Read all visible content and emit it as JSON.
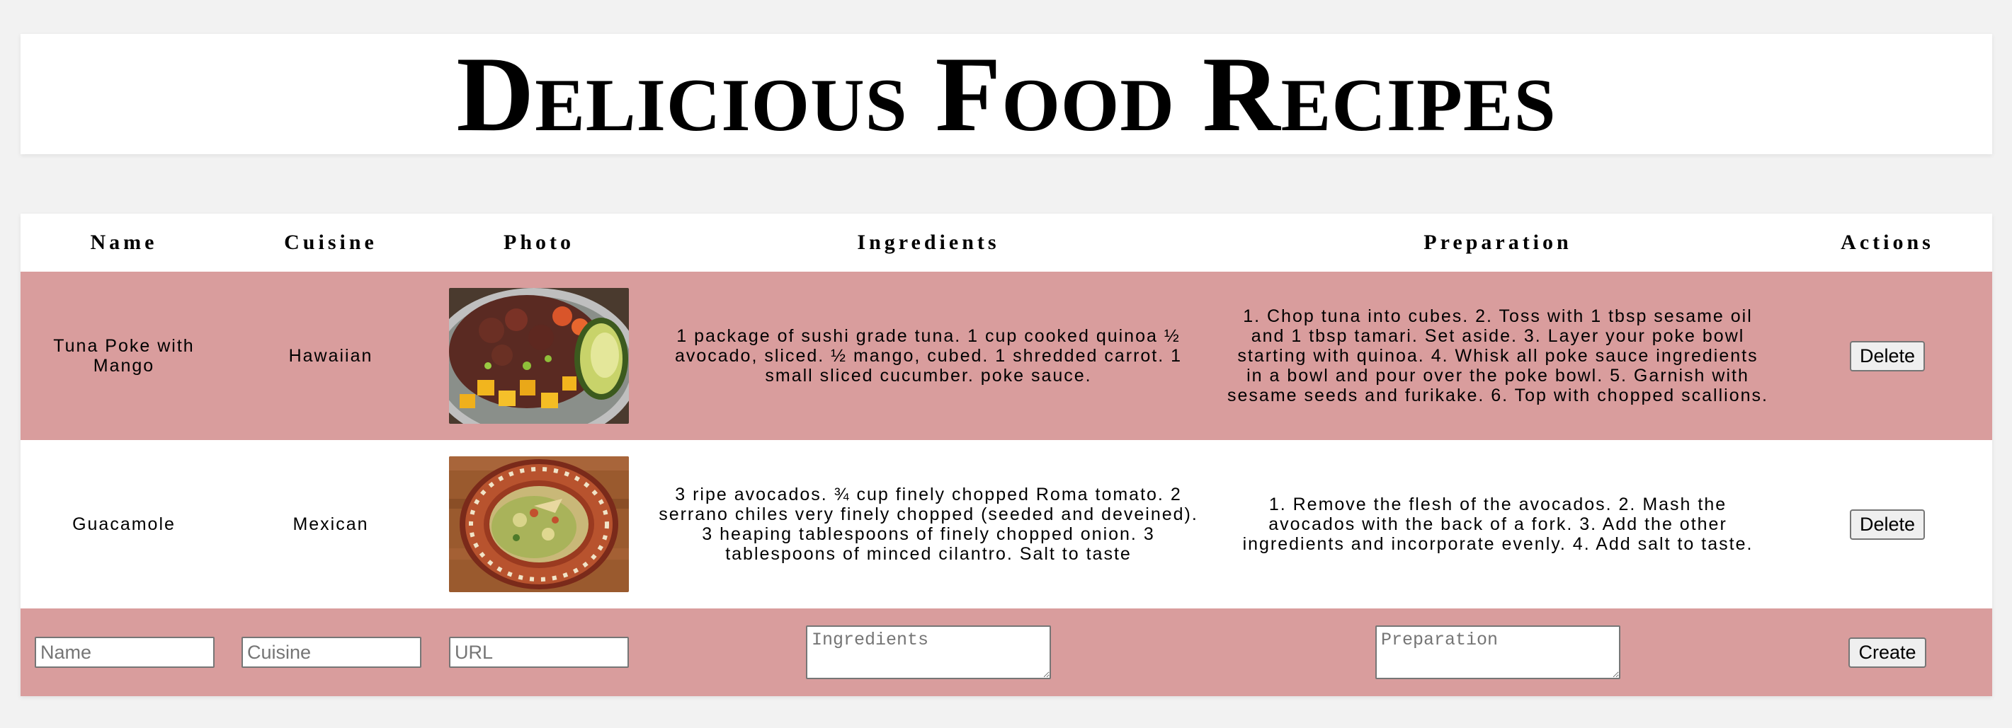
{
  "page": {
    "title": "Delicious Food Recipes"
  },
  "table": {
    "headers": [
      "Name",
      "Cuisine",
      "Photo",
      "Ingredients",
      "Preparation",
      "Actions"
    ]
  },
  "recipes": [
    {
      "name": "Tuna Poke with Mango",
      "cuisine": "Hawaiian",
      "photo_description": "poke bowl with tuna, mango, avocado",
      "ingredients": "1 package of sushi grade tuna. 1 cup cooked quinoa ½ avocado, sliced. ½ mango, cubed. 1 shredded carrot. 1 small sliced cucumber. poke sauce.",
      "preparation": "1. Chop tuna into cubes. 2. Toss with 1 tbsp sesame oil and 1 tbsp tamari. Set aside. 3. Layer your poke bowl starting with quinoa. 4. Whisk all poke sauce ingredients in a bowl and pour over the poke bowl. 5. Garnish with sesame seeds and furikake. 6. Top with chopped scallions.",
      "action_label": "Delete"
    },
    {
      "name": "Guacamole",
      "cuisine": "Mexican",
      "photo_description": "guacamole on decorative plate",
      "ingredients": "3 ripe avocados. ¾ cup finely chopped Roma tomato. 2 serrano chiles very finely chopped (seeded and deveined). 3 heaping tablespoons of finely chopped onion. 3 tablespoons of minced cilantro. Salt to taste",
      "preparation": "1. Remove the flesh of the avocados. 2. Mash the avocados with the back of a fork. 3. Add the other ingredients and incorporate evenly. 4. Add salt to taste.",
      "action_label": "Delete"
    }
  ],
  "form": {
    "name_placeholder": "Name",
    "name_value": "",
    "cuisine_placeholder": "Cuisine",
    "cuisine_value": "",
    "url_placeholder": "URL",
    "url_value": "",
    "ingredients_placeholder": "Ingredients",
    "ingredients_value": "",
    "preparation_placeholder": "Preparation",
    "preparation_value": "",
    "create_label": "Create"
  },
  "colors": {
    "row_pink": "#d99d9d",
    "row_white": "#ffffff",
    "page_background": "#f2f2f2"
  }
}
